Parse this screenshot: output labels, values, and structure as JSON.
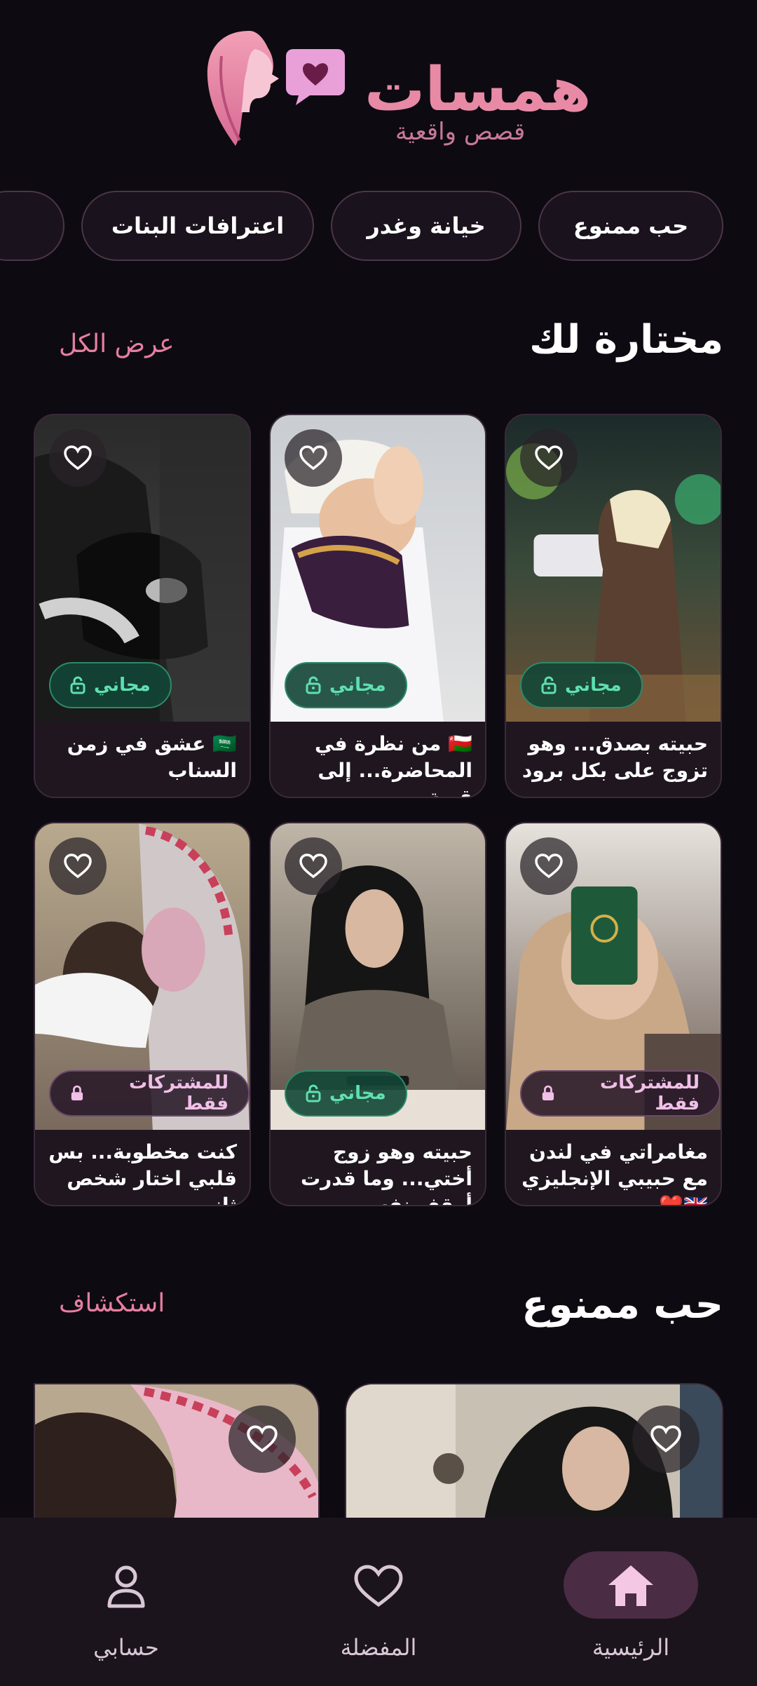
{
  "app": {
    "title": "همسات",
    "subtitle": "قصص واقعية"
  },
  "categories": [
    "حب ممنوع",
    "خيانة وغدر",
    "اعترافات البنات"
  ],
  "featured": {
    "title": "مختارة لك",
    "link": "عرض الكل",
    "cards": [
      {
        "title": "حبيته بصدق... وهو تزوج على بكل برود",
        "badge": "مجاني",
        "badge_type": "free"
      },
      {
        "title": "🇴🇲 من نظرة في المحاضرة... إلى قصة",
        "badge": "مجاني",
        "badge_type": "free"
      },
      {
        "title": "🇸🇦 عشق في زمن السناب",
        "badge": "مجاني",
        "badge_type": "free"
      },
      {
        "title": "مغامراتي في لندن مع حبيبي الإنجليزي 🇬🇧❤️",
        "badge": "للمشتركات فقط",
        "badge_type": "sub"
      },
      {
        "title": "حبيته وهو زوج أختي... وما قدرت أوقف نفسي...",
        "badge": "مجاني",
        "badge_type": "free"
      },
      {
        "title": "كنت مخطوبة... بس قلبي اختار شخص ثاني",
        "badge": "للمشتركات فقط",
        "badge_type": "sub"
      }
    ]
  },
  "forbidden_section": {
    "title": "حب ممنوع",
    "link": "استكشاف"
  },
  "nav": {
    "home": "الرئيسية",
    "favorites": "المفضلة",
    "account": "حسابي"
  },
  "colors": {
    "background": "#0e0a12",
    "accent_pink": "#e88aa6",
    "free_green": "#5fe0b0",
    "nav_active": "#4a2c44"
  }
}
